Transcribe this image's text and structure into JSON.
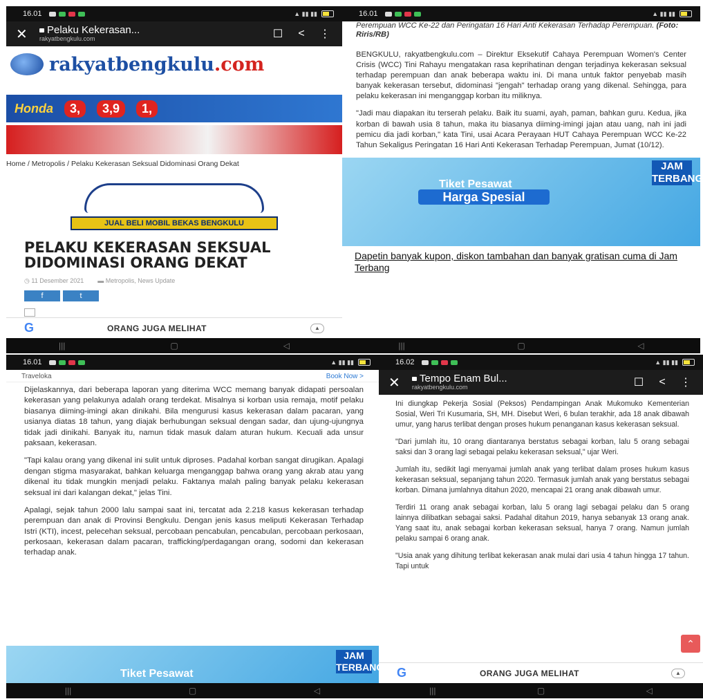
{
  "panel1": {
    "status_time": "16.01",
    "browser_title": "Pelaku Kekerasan...",
    "browser_url": "rakyatbengkulu.com",
    "logo_main": "rakyatbengkulu",
    "logo_dotcom": ".com",
    "banner1_left": "3,",
    "banner1_mid": "3,9",
    "banner1_right": "1,",
    "breadcrumb": "Home / Metropolis / Pelaku Kekerasan Seksual Didominasi Orang Dekat",
    "car_ad_caption": "JUAL BELI MOBIL BEKAS BENGKULU",
    "headline": "PELAKU KEKERASAN SEKSUAL DIDOMINASI ORANG DEKAT",
    "date": "11 Desember 2021",
    "categories": "Metropolis, News Update",
    "share_facebook": "f",
    "share_twitter": "t",
    "also_see": "ORANG JUGA MELIHAT"
  },
  "panel2": {
    "status_time": "16.01",
    "caption": "Perempuan WCC Ke-22 dan Peringatan 16 Hari Anti Kekerasan Terhadap Perempuan.",
    "caption_credit": "(Foto: Riris/RB)",
    "paragraph1": "BENGKULU, rakyatbengkulu.com – Direktur Eksekutif Cahaya Perempuan Women's Center Crisis (WCC) Tini Rahayu mengatakan rasa keprihatinan dengan terjadinya kekerasan seksual terhadap perempuan dan anak beberapa waktu ini. Di mana untuk faktor penyebab masih banyak kekerasan tersebut, didominasi \"jengah\" terhadap orang yang dikenal. Sehingga, para pelaku kekerasan ini menganggap korban itu miliknya.",
    "paragraph2": "\"Jadi mau diapakan itu terserah pelaku. Baik itu suami, ayah, paman, bahkan guru. Kedua, jika korban di bawah usia 8 tahun, maka itu biasanya diiming-imingi jajan atau uang, nah ini jadi pemicu dia jadi korban,\" kata Tini, usai Acara Perayaan HUT Cahaya Perempuan WCC Ke-22 Tahun Sekaligus Peringatan 16 Hari Anti Kekerasan Terhadap Perempuan, Jumat (10/12).",
    "ad_title": "Tiket Pesawat",
    "ad_subtitle": "Harga Spesial",
    "ad_brand": "JAM TERBANG",
    "ad_link": "Dapetin banyak kupon, diskon tambahan dan banyak gratisan cuma di Jam Terbang"
  },
  "panel3": {
    "status_time": "16.01",
    "sponsor": "Traveloka",
    "book_now": "Book Now >",
    "paragraph1": "Dijelaskannya, dari beberapa laporan yang diterima WCC memang banyak didapati persoalan kekerasan yang pelakunya adalah orang terdekat. Misalnya si korban usia remaja, motif pelaku biasanya diiming-imingi akan dinikahi. Bila mengurusi kasus kekerasan dalam pacaran, yang usianya diatas 18 tahun, yang diajak berhubungan seksual dengan sadar, dan ujung-ujungnya tidak jadi dinikahi. Banyak itu, namun tidak masuk dalam aturan hukum. Kecuali ada unsur paksaan, kekerasan.",
    "paragraph2": "\"Tapi kalau orang yang dikenal ini sulit untuk diproses. Padahal korban sangat dirugikan. Apalagi dengan stigma masyarakat, bahkan keluarga menganggap bahwa orang yang akrab atau yang dikenal itu tidak mungkin menjadi pelaku. Faktanya malah paling banyak pelaku kekerasan seksual ini dari kalangan dekat,\" jelas Tini.",
    "paragraph3": "Apalagi, sejak tahun 2000 lalu sampai saat ini, tercatat ada 2.218 kasus kekerasan terhadap perempuan dan anak di Provinsi Bengkulu. Dengan jenis kasus meliputi Kekerasan Terhadap Istri (KTI), incest, pelecehan seksual, percobaan pencabulan, pencabulan, percobaan perkosaan, perkosaan, kekerasan dalam pacaran, trafficking/perdagangan orang, sodomi dan kekerasan terhadap anak.",
    "ad_title": "Tiket Pesawat",
    "ad_brand": "JAM TERBANG"
  },
  "panel4": {
    "status_time": "16.02",
    "browser_title": "Tempo Enam Bul...",
    "browser_url": "rakyatbengkulu.com",
    "paragraph1": "Ini diungkap Pekerja Sosial (Peksos) Pendampingan Anak Mukomuko Kementerian Sosial, Weri Tri Kusumaria, SH, MH. Disebut Weri, 6 bulan terakhir, ada 18 anak dibawah umur, yang harus terlibat dengan proses hukum penanganan kasus kekerasan seksual.",
    "paragraph2": "\"Dari jumlah itu, 10 orang diantaranya berstatus sebagai korban, lalu 5 orang sebagai saksi dan 3 orang lagi sebagai pelaku kekerasan seksual,\" ujar Weri.",
    "paragraph3": "Jumlah itu, sedikit lagi menyamai jumlah anak yang terlibat dalam proses hukum kasus kekerasan seksual, sepanjang tahun 2020. Termasuk jumlah anak yang berstatus sebagai korban. Dimana jumlahnya ditahun 2020, mencapai 21 orang anak dibawah umur.",
    "paragraph4": "Terdiri 11 orang anak sebagai korban, lalu 5 orang lagi sebagai pelaku dan 5 orang lainnya dilibatkan sebagai saksi. Padahal ditahun 2019, hanya sebanyak 13 orang anak. Yang saat itu, anak sebagai korban kekerasan seksual, hanya 7 orang. Namun jumlah pelaku sampai 6 orang anak.",
    "paragraph5": "\"Usia anak yang dihitung terlibat kekerasan anak mulai dari usia 4 tahun hingga 17 tahun. Tapi untuk",
    "also_see": "ORANG JUGA MELIHAT"
  },
  "colors": {
    "brand_blue": "#1d4fa3",
    "brand_red": "#d4241f",
    "link_blue": "#2d7ad4"
  }
}
